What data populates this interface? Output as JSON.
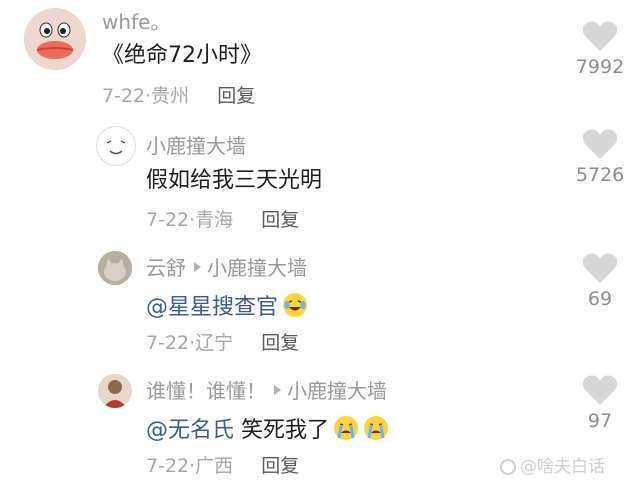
{
  "comments": [
    {
      "author": "whfe。",
      "content": "《绝命72小时》",
      "date": "7-22",
      "location": "贵州",
      "reply_label": "回复",
      "likes": "7992",
      "avatar": "duck-lips-face"
    },
    {
      "author": "小鹿撞大墙",
      "content": "假如给我三天光明",
      "date": "7-22",
      "location": "青海",
      "reply_label": "回复",
      "likes": "5726",
      "avatar": "smiley-doodle"
    },
    {
      "author": "云舒",
      "reply_to": "小鹿撞大墙",
      "mention": "@星星搜查官",
      "content": "",
      "emoji": [
        "laughing-crying-emoji"
      ],
      "date": "7-22",
      "location": "辽宁",
      "reply_label": "回复",
      "likes": "69",
      "avatar": "cat-photo"
    },
    {
      "author": "谁懂！谁懂！",
      "reply_to": "小鹿撞大墙",
      "mention": "@无名氏",
      "content": "笑死我了",
      "emoji": [
        "crying-emoji",
        "crying-emoji"
      ],
      "date": "7-22",
      "location": "广西",
      "reply_label": "回复",
      "likes": "97",
      "avatar": "person-photo"
    }
  ],
  "meta_separator": "·",
  "watermark": "@啥夫白话"
}
